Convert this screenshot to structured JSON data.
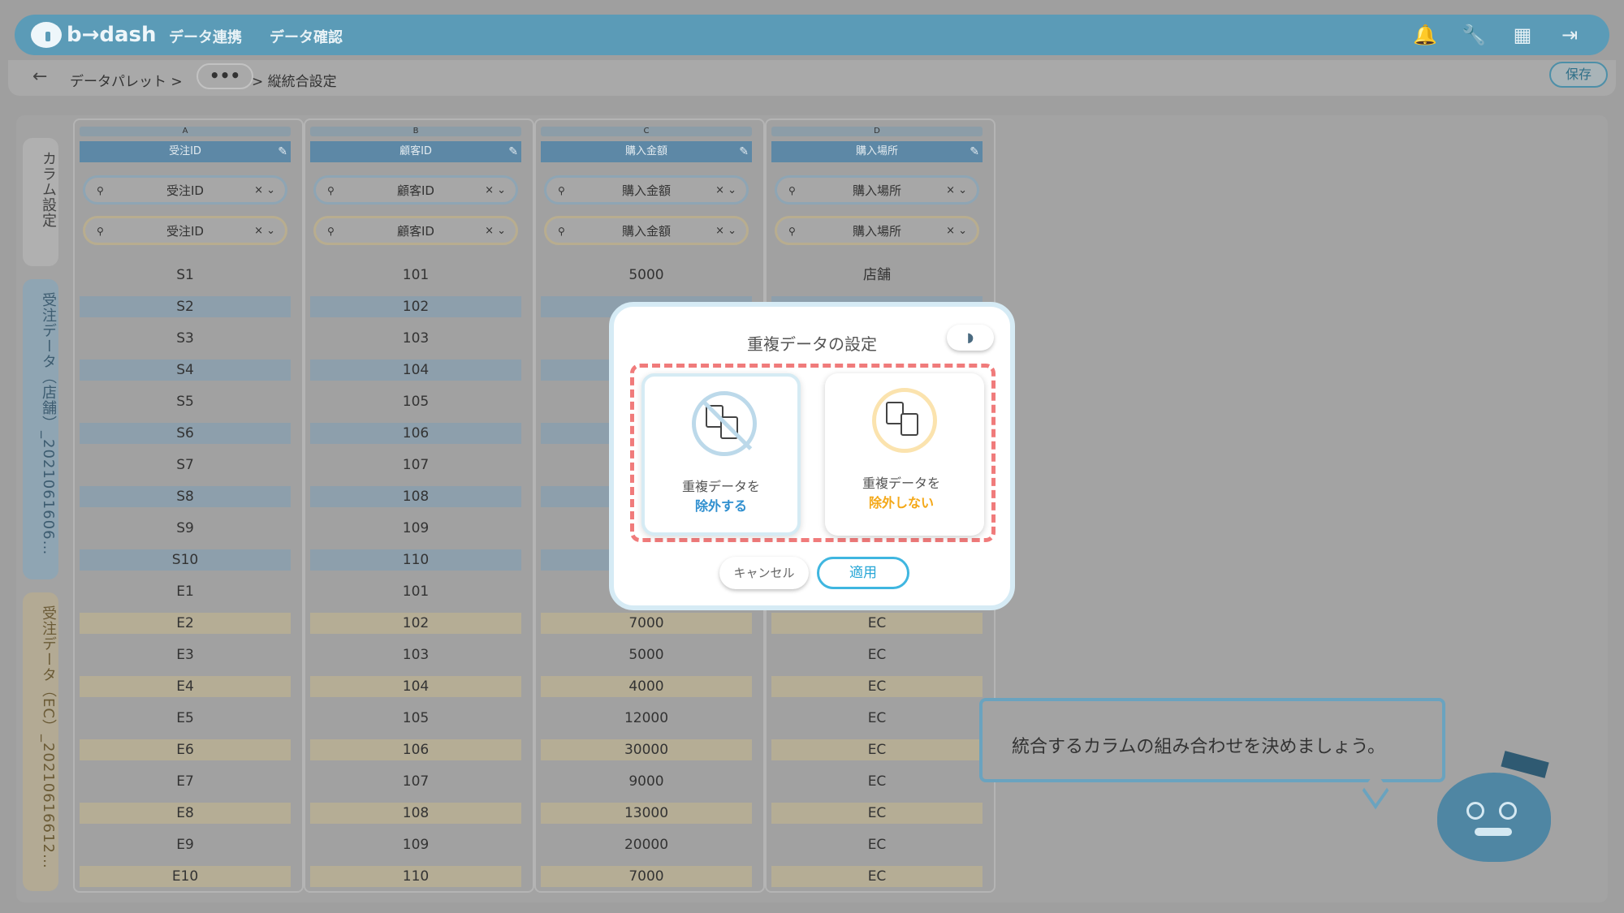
{
  "header": {
    "logo": "b→dash",
    "nav": [
      "データ連携",
      "データ確認"
    ]
  },
  "breadcrumb": {
    "root": "データパレット >",
    "more": "•••",
    "current": "> 縦統合設定",
    "save": "保存"
  },
  "side_tabs": [
    "カラム設定",
    "受注データ（店舗）_2021061606…",
    "受注データ（EC）_20210616612…"
  ],
  "columns": [
    {
      "letter": "A",
      "header": "受注ID",
      "select1": "受注ID",
      "select2": "受注ID",
      "values": [
        "S1",
        "S2",
        "S3",
        "S4",
        "S5",
        "S6",
        "S7",
        "S8",
        "S9",
        "S10",
        "E1",
        "E2",
        "E3",
        "E4",
        "E5",
        "E6",
        "E7",
        "E8",
        "E9",
        "E10"
      ]
    },
    {
      "letter": "B",
      "header": "顧客ID",
      "select1": "顧客ID",
      "select2": "顧客ID",
      "values": [
        "101",
        "102",
        "103",
        "104",
        "105",
        "106",
        "107",
        "108",
        "109",
        "110",
        "101",
        "102",
        "103",
        "104",
        "105",
        "106",
        "107",
        "108",
        "109",
        "110"
      ]
    },
    {
      "letter": "C",
      "header": "購入金額",
      "select1": "購入金額",
      "select2": "購入金額",
      "values": [
        "5000",
        "",
        "",
        "",
        "",
        "",
        "",
        "",
        "",
        "",
        "",
        "7000",
        "5000",
        "4000",
        "12000",
        "30000",
        "9000",
        "13000",
        "20000",
        "7000"
      ]
    },
    {
      "letter": "D",
      "header": "購入場所",
      "select1": "購入場所",
      "select2": "購入場所",
      "values": [
        "店舗",
        "",
        "",
        "",
        "",
        "",
        "",
        "",
        "",
        "",
        "",
        "EC",
        "EC",
        "EC",
        "EC",
        "EC",
        "EC",
        "EC",
        "EC",
        "EC"
      ]
    }
  ],
  "modal": {
    "title": "重複データの設定",
    "option_exclude": {
      "line1": "重複データを",
      "line2": "除外する"
    },
    "option_keep": {
      "line1": "重複データを",
      "line2": "除外しない"
    },
    "cancel": "キャンセル",
    "apply": "適用"
  },
  "speech": "統合するカラムの組み合わせを決めましょう。"
}
